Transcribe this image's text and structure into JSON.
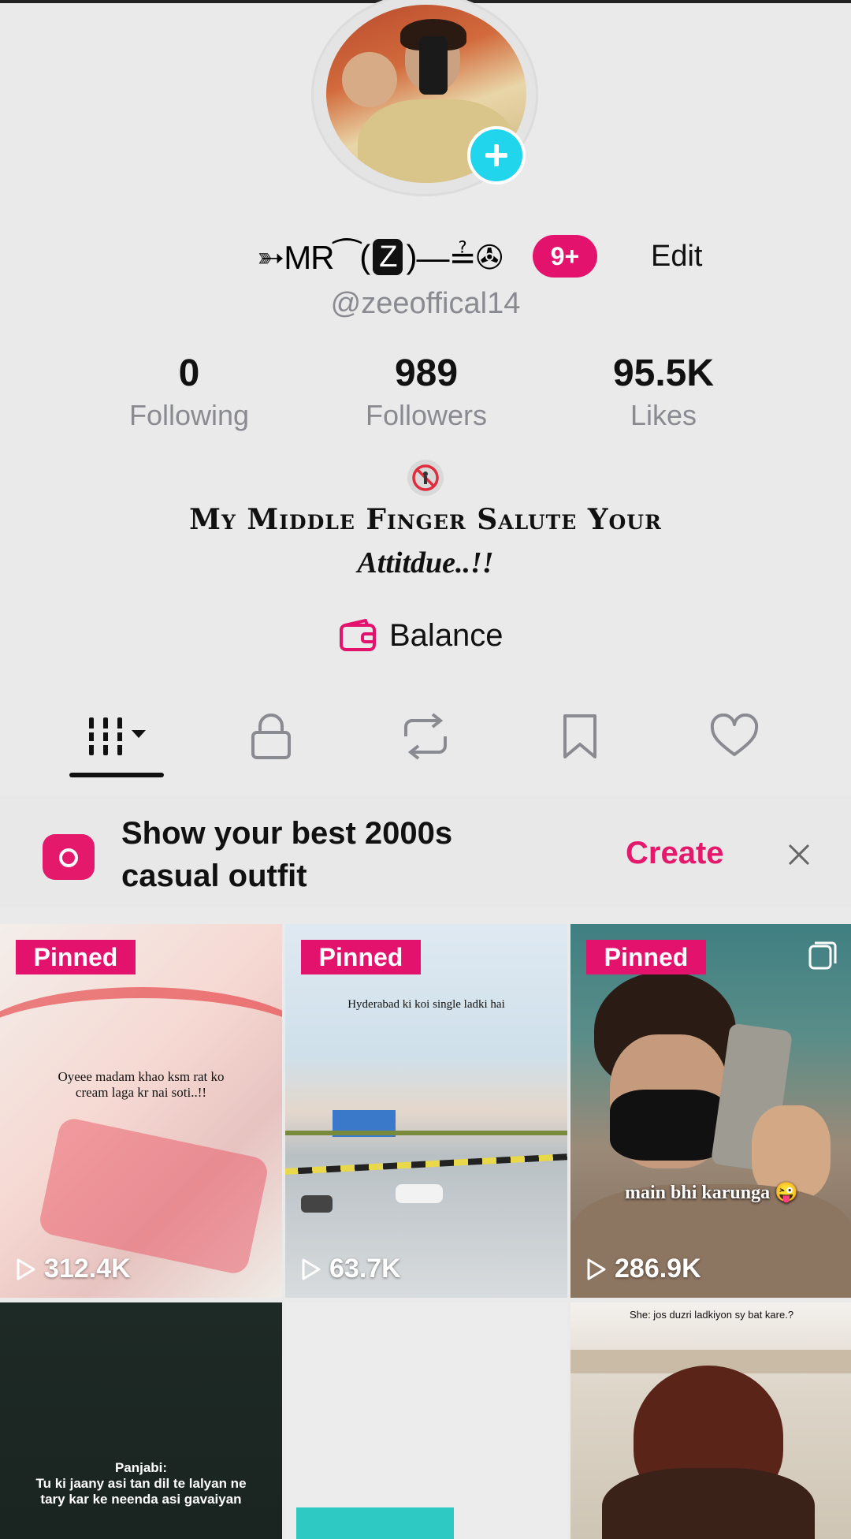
{
  "profile": {
    "display_name_prefix": "➳MR⁀",
    "display_name_z": "Z",
    "display_name_suffix": "—≟✇",
    "notification_badge": "9+",
    "edit_label": "Edit",
    "handle": "@zeeoffical14"
  },
  "stats": [
    {
      "value": "0",
      "label": "Following"
    },
    {
      "value": "989",
      "label": "Followers"
    },
    {
      "value": "95.5K",
      "label": "Likes"
    }
  ],
  "bio": {
    "line1": "My Middle Finger Salute Your",
    "line2": "Attitdue..!!"
  },
  "balance": {
    "label": "Balance"
  },
  "tabs": [
    "videos-grid",
    "private",
    "reposts",
    "favorites",
    "liked"
  ],
  "prompt": {
    "text": "Show your best 2000s casual outfit",
    "action": "Create"
  },
  "videos": [
    {
      "pinned": "Pinned",
      "views": "312.4K",
      "caption": "Oyeee madam khao ksm rat ko cream laga kr nai soti..!!"
    },
    {
      "pinned": "Pinned",
      "views": "63.7K",
      "caption": "Hyderabad ki koi single ladki hai"
    },
    {
      "pinned": "Pinned",
      "views": "286.9K",
      "caption": "main bhi karunga 😜"
    },
    {
      "caption": "Panjabi:\nTu ki jaany asi tan dil te lalyan ne tary kar ke neenda asi gavaiyan"
    },
    {
      "caption": ""
    },
    {
      "caption": "She: jos duzri ladkiyon sy bat kare.?"
    }
  ],
  "colors": {
    "accent": "#e3126d",
    "plus": "#20d5ec",
    "muted": "#8a8b91"
  }
}
